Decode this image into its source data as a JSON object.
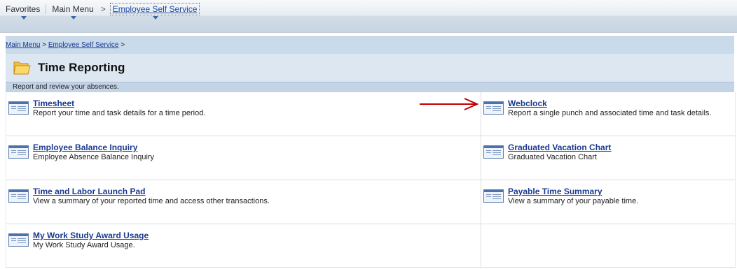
{
  "topnav": {
    "favorites": "Favorites",
    "main_menu": "Main Menu",
    "separator": ">",
    "current": "Employee Self Service"
  },
  "breadcrumb": {
    "main_menu": "Main Menu",
    "sep1": ">",
    "employee_self_service": "Employee Self Service",
    "sep2": ">"
  },
  "page": {
    "title": "Time Reporting",
    "description": "Report and review your absences."
  },
  "items": [
    {
      "title": "Timesheet",
      "desc": "Report your time and task details for a time period."
    },
    {
      "title": "Webclock",
      "desc": "Report a single punch and associated time and task details."
    },
    {
      "title": "Employee Balance Inquiry",
      "desc": "Employee Absence Balance Inquiry"
    },
    {
      "title": "Graduated Vacation Chart",
      "desc": "Graduated Vacation Chart"
    },
    {
      "title": "Time and Labor Launch Pad",
      "desc": "View a summary of your reported time and access other transactions."
    },
    {
      "title": "Payable Time Summary",
      "desc": "View a summary of your payable time."
    },
    {
      "title": "My Work Study Award Usage",
      "desc": "My Work Study Award Usage."
    }
  ],
  "colors": {
    "link": "#1a3a8f",
    "annotation_arrow": "#c00000"
  }
}
